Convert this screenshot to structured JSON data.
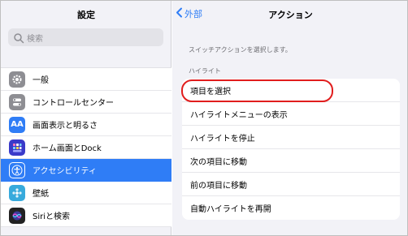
{
  "left_pane": {
    "title": "設定",
    "search_placeholder": "検索",
    "items": [
      {
        "label": "一般",
        "icon": "gear-icon",
        "color": "#8e8e93"
      },
      {
        "label": "コントロールセンター",
        "icon": "toggles-icon",
        "color": "#8e8e93"
      },
      {
        "label": "画面表示と明るさ",
        "icon": "text-size-icon",
        "icon_text": "AA",
        "color": "#2f7df6"
      },
      {
        "label": "ホーム画面とDock",
        "icon": "home-grid-icon",
        "color": "#3a3ac9"
      },
      {
        "label": "アクセシビリティ",
        "icon": "accessibility-icon",
        "color": "#2f7df6",
        "selected": true
      },
      {
        "label": "壁紙",
        "icon": "wallpaper-icon",
        "color": "#37aadc"
      },
      {
        "label": "Siriと検索",
        "icon": "siri-icon",
        "color": "#222222"
      }
    ]
  },
  "right_pane": {
    "back_label": "外部",
    "title": "アクション",
    "description": "スイッチアクションを選択します。",
    "section_header": "ハイライト",
    "rows": [
      "項目を選択",
      "ハイライトメニューの表示",
      "ハイライトを停止",
      "次の項目に移動",
      "前の項目に移動",
      "自動ハイライトを再開"
    ]
  },
  "colors": {
    "accent": "#2f7df6",
    "annotation": "#e11d1d"
  }
}
